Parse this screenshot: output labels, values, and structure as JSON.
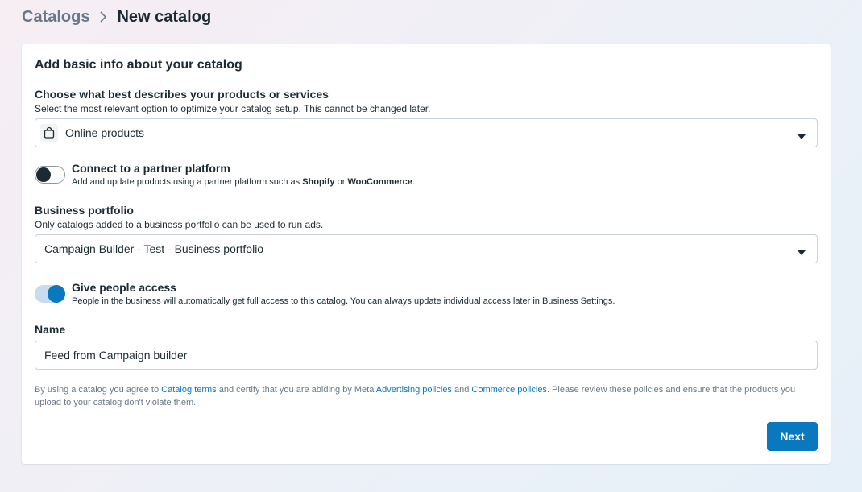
{
  "breadcrumb": {
    "root": "Catalogs",
    "current": "New catalog"
  },
  "card": {
    "title": "Add basic info about your catalog",
    "product_type": {
      "label": "Choose what best describes your products or services",
      "help": "Select the most relevant option to optimize your catalog setup. This cannot be changed later.",
      "value": "Online products",
      "icon": "shopping-bag-icon"
    },
    "partner": {
      "title": "Connect to a partner platform",
      "desc_prefix": "Add and update products using a partner platform such as ",
      "shopify": "Shopify",
      "or": " or ",
      "woocommerce": "WooCommerce",
      "period": ".",
      "enabled": false
    },
    "portfolio": {
      "label": "Business portfolio",
      "help": "Only catalogs added to a business portfolio can be used to run ads.",
      "value": "Campaign Builder - Test - Business portfolio"
    },
    "access": {
      "title": "Give people access",
      "desc": "People in the business will automatically get full access to this catalog. You can always update individual access later in Business Settings.",
      "enabled": true
    },
    "name": {
      "label": "Name",
      "value": "Feed from Campaign builder"
    },
    "terms": {
      "t1": "By using a catalog you agree to ",
      "link1": "Catalog terms",
      "t2": " and certify that you are abiding by Meta ",
      "link2": "Advertising policies",
      "t3": " and ",
      "link3": "Commerce policies",
      "t4": ". Please review these policies and ensure that the products you upload to your catalog don't violate them."
    },
    "next_label": "Next"
  },
  "colors": {
    "accent": "#0a78be",
    "text": "#1c2b33",
    "muted": "#67788a"
  }
}
